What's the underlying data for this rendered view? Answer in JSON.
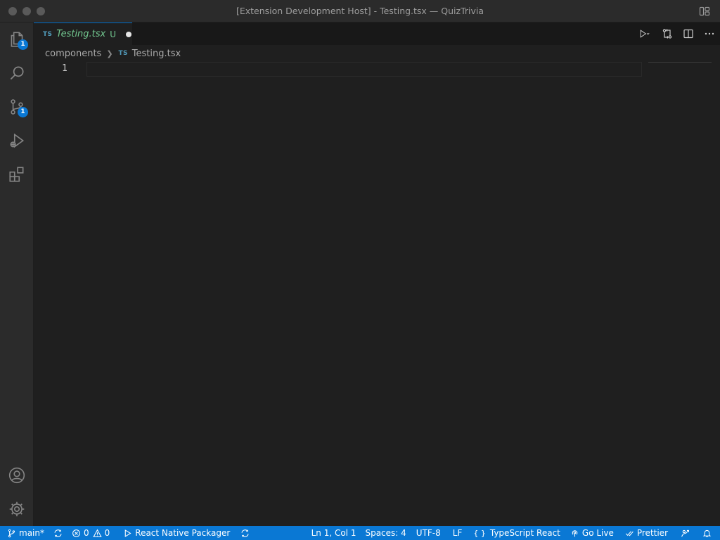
{
  "window": {
    "title": "[Extension Development Host] - Testing.tsx — QuizTrivia"
  },
  "activity_bar": {
    "explorer_badge": "1",
    "source_control_badge": "1"
  },
  "tab": {
    "lang_badge": "TS",
    "name": "Testing.tsx",
    "status": "U"
  },
  "breadcrumb": {
    "folder": "components",
    "lang_badge": "TS",
    "file": "Testing.tsx"
  },
  "editor": {
    "line_number": "1"
  },
  "status_bar": {
    "branch": "main*",
    "errors": "0",
    "warnings": "0",
    "packager": "React Native Packager",
    "cursor": "Ln 1, Col 1",
    "indent": "Spaces: 4",
    "encoding": "UTF-8",
    "eol": "LF",
    "language_braces": "{ }",
    "language": "TypeScript React",
    "go_live": "Go Live",
    "prettier": "Prettier"
  },
  "colors": {
    "accent": "#0a78d4",
    "modified": "#73c991",
    "ts_badge": "#519aba"
  }
}
